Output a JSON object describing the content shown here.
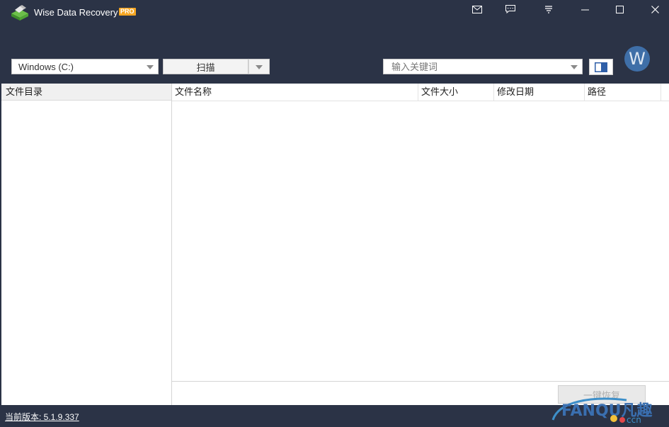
{
  "app": {
    "title": "Wise Data Recovery",
    "badge": "PRO",
    "accent_color": "#2b3346",
    "badge_color": "#f5a623"
  },
  "window_controls": [
    "mail-icon",
    "feedback-icon",
    "menu-icon",
    "minimize-icon",
    "maximize-icon",
    "close-icon"
  ],
  "avatar": {
    "letter": "W"
  },
  "toolbar": {
    "drive": "Windows (C:)",
    "scan_label": "扫描",
    "search_placeholder": "输入关键词"
  },
  "left_pane": {
    "header": "文件目录"
  },
  "file_list": {
    "columns": [
      "文件名称",
      "文件大小",
      "修改日期",
      "路径"
    ],
    "rows": []
  },
  "recover_button": "一键恢复",
  "status": {
    "version": "当前版本: 5.1.9.337"
  },
  "watermark": {
    "text": "FANQU凡趣",
    "sub": "ccn"
  }
}
